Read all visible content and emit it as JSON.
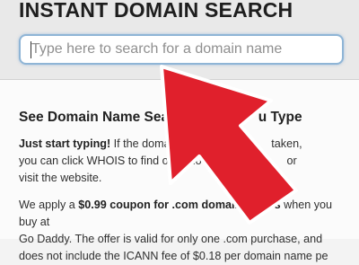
{
  "header": {
    "title": "INSTANT DOMAIN SEARCH"
  },
  "search": {
    "placeholder": "Type here to search for a domain name"
  },
  "main": {
    "section_title": "See Domain Name Search R",
    "section_title_end": "u Type",
    "para1": {
      "lead": "Just start typing!",
      "line1_rest": " If the domain name y",
      "line1_end": "taken,",
      "line2": "you can click WHOIS to find out who regis",
      "line2_end": "or",
      "line3": "visit the website."
    },
    "para2": {
      "t1": "We apply a ",
      "coupon": "$0.99 coupon for .com domain names",
      "t2": " when you buy at",
      "line2": "Go Daddy. The offer is valid for only one .com purchase, and",
      "line3": "does not include the ICANN fee of $0.18 per domain name pe"
    }
  },
  "overlay": {
    "arrow_color": "#e0202c",
    "arrow_outline": "#ffffff"
  }
}
